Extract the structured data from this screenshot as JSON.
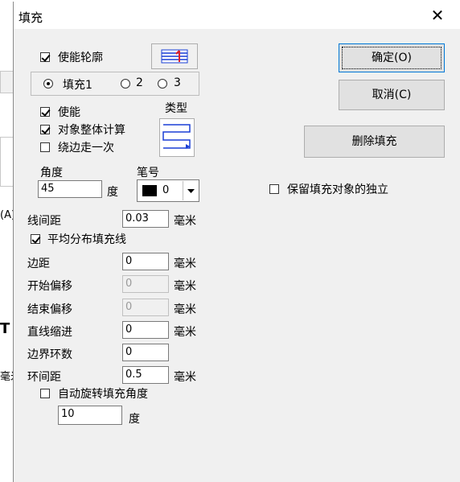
{
  "dialog": {
    "title": "填充",
    "close_glyph": "✕"
  },
  "background_app": {
    "glyph_a": "(A)",
    "glyph_t": "T",
    "glyph_mi": "毫米"
  },
  "outline": {
    "enable_label": "使能轮廓",
    "enable_checked": true
  },
  "fill_tabs": {
    "items": [
      {
        "label": "填充1",
        "selected": true
      },
      {
        "label": "2",
        "selected": false
      },
      {
        "label": "3",
        "selected": false
      }
    ]
  },
  "fill": {
    "enable_label": "使能",
    "enable_checked": true,
    "whole_calc_label": "对象整体计算",
    "whole_calc_checked": true,
    "edge_once_label": "绕边走一次",
    "edge_once_checked": false,
    "type_label": "类型",
    "angle_label": "角度",
    "angle_value": "45",
    "angle_unit": "度",
    "pen_label": "笔号",
    "pen_value": "0",
    "pen_color": "#000000"
  },
  "params": {
    "line_spacing_label": "线间距",
    "line_spacing_value": "0.03",
    "avg_distribute_label": "平均分布填充线",
    "avg_distribute_checked": true,
    "margin_label": "边距",
    "margin_value": "0",
    "start_offset_label": "开始偏移",
    "start_offset_value": "0",
    "end_offset_label": "结束偏移",
    "end_offset_value": "0",
    "line_indent_label": "直线缩进",
    "line_indent_value": "0",
    "border_loops_label": "边界环数",
    "border_loops_value": "0",
    "loop_spacing_label": "环间距",
    "loop_spacing_value": "0.5",
    "unit_mm": "毫米",
    "auto_rotate_label": "自动旋转填充角度",
    "auto_rotate_checked": false,
    "rotate_value": "10",
    "rotate_unit": "度"
  },
  "buttons": {
    "ok_label": "确定(O)",
    "cancel_label": "取消(C)",
    "delete_fill_label": "删除填充"
  },
  "keep_independent": {
    "label": "保留填充对象的独立",
    "checked": false
  },
  "colors": {
    "accent": "#0078d7",
    "hatch_blue": "#1a3fd6",
    "hatch_red": "#e0202a"
  }
}
